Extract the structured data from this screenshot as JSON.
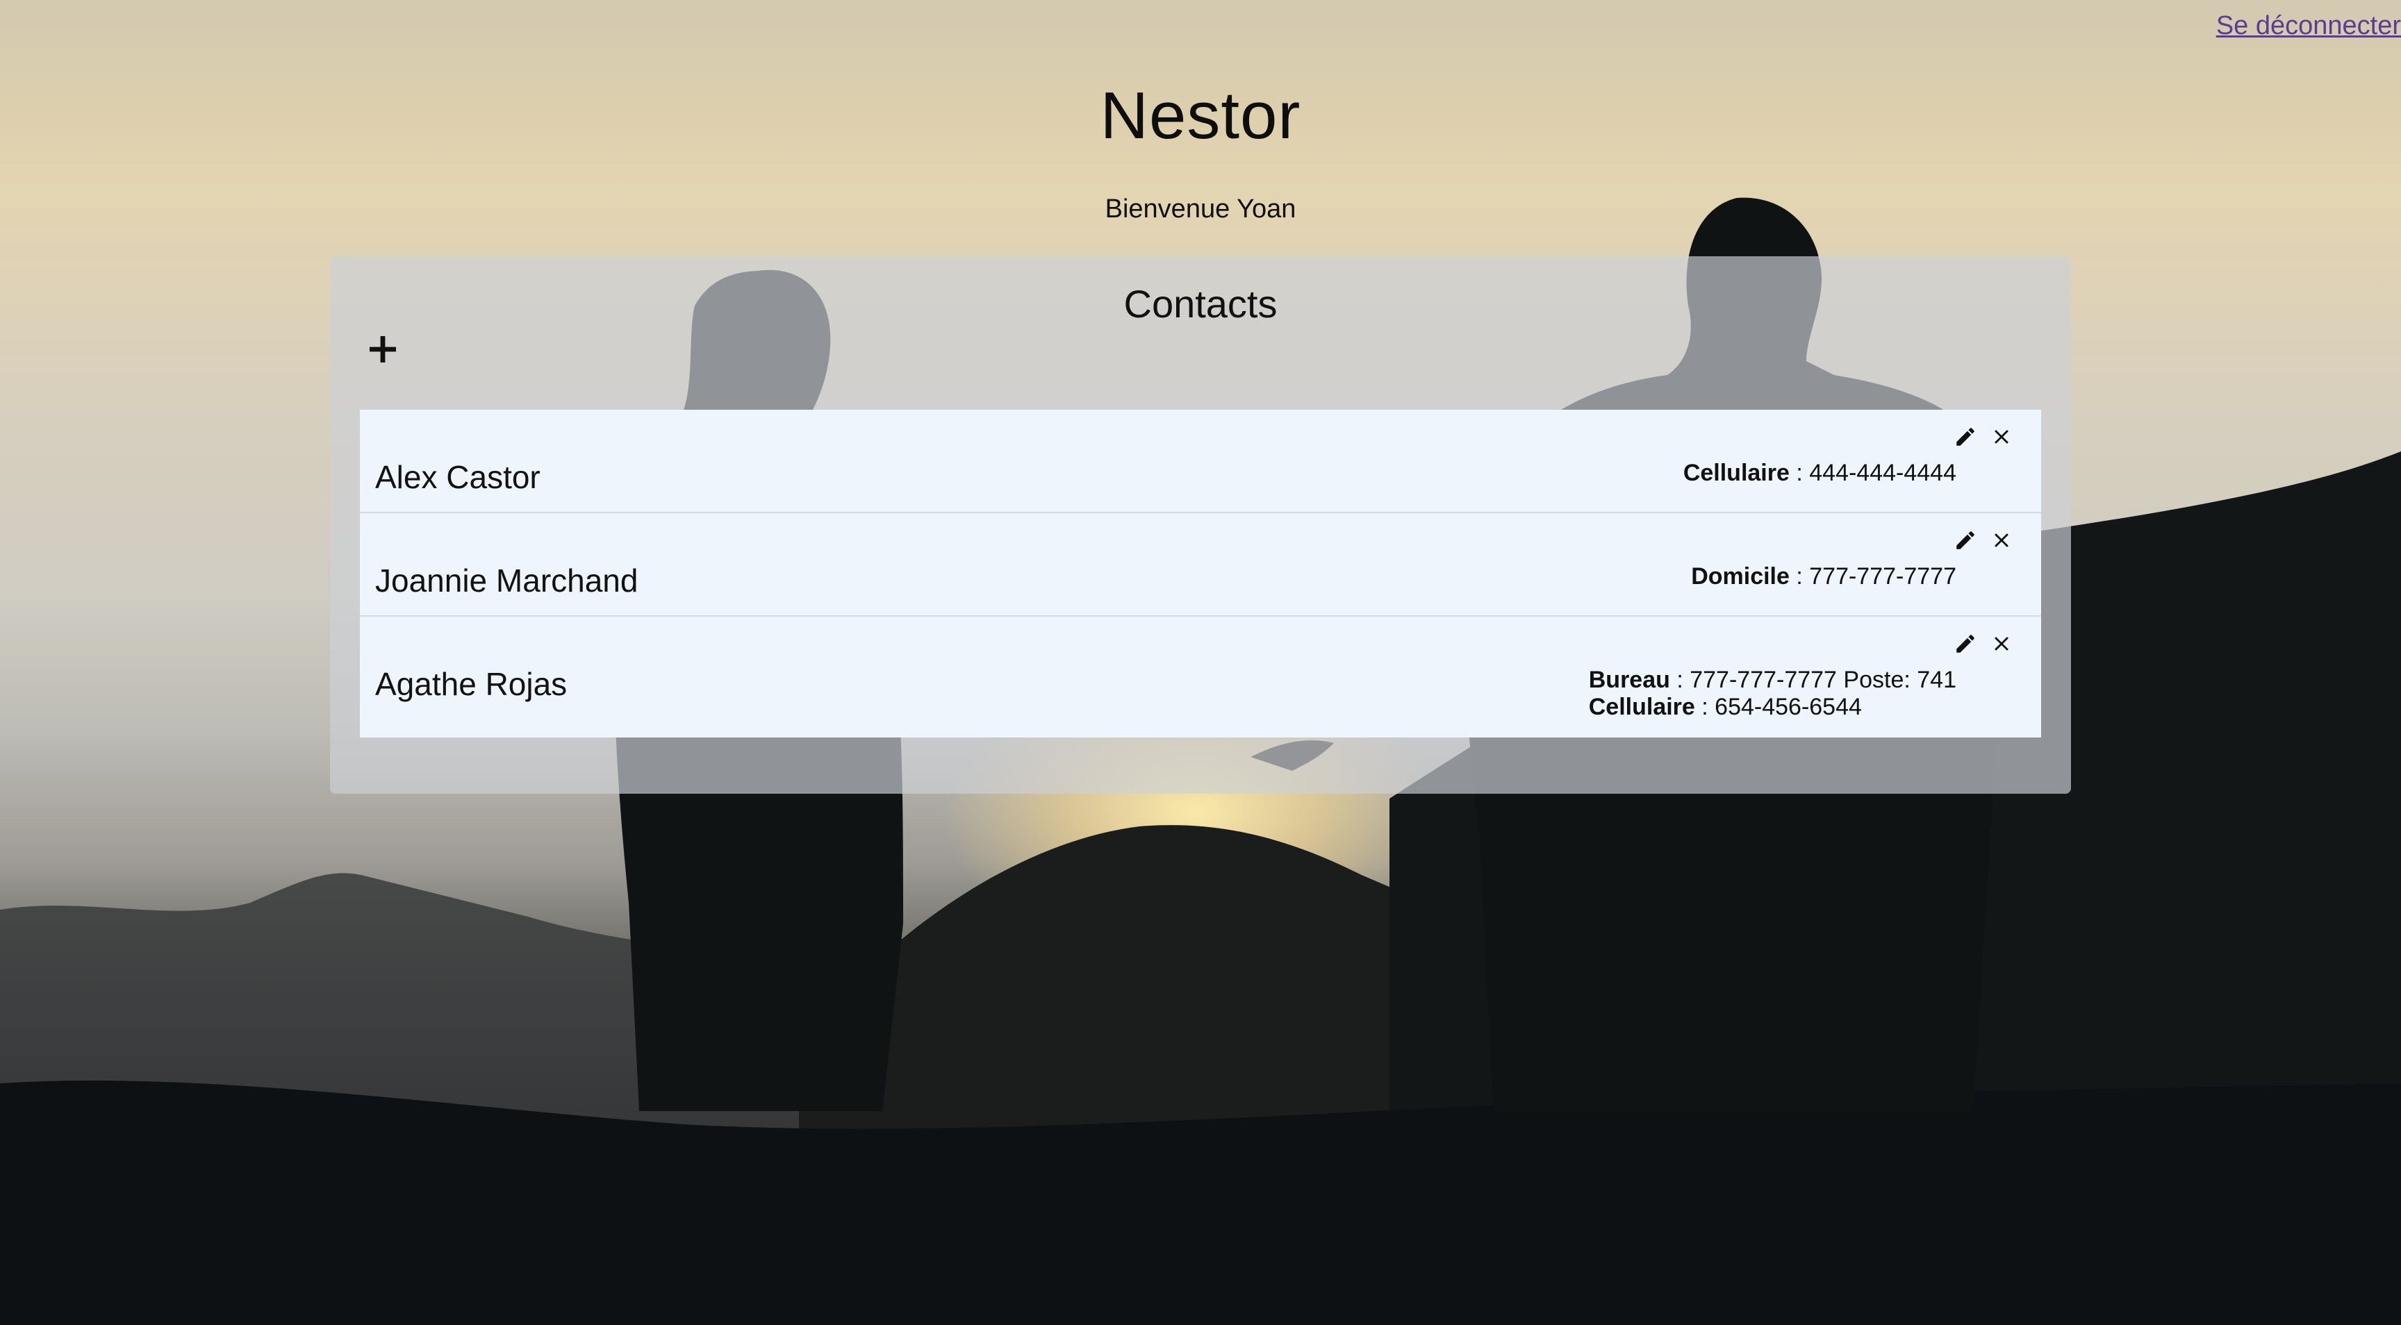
{
  "header": {
    "logout_label": "Se déconnecter",
    "app_title": "Nestor",
    "welcome_text": "Bienvenue Yoan"
  },
  "contacts": {
    "title": "Contacts",
    "add_icon": "plus-icon",
    "edit_icon": "pencil-icon",
    "delete_icon": "close-icon",
    "items": [
      {
        "name": "Alex Castor",
        "phones": [
          {
            "type": "Cellulaire",
            "separator": " : ",
            "number": "444-444-4444",
            "extra": ""
          }
        ]
      },
      {
        "name": "Joannie Marchand",
        "phones": [
          {
            "type": "Domicile",
            "separator": " : ",
            "number": "777-777-7777",
            "extra": ""
          }
        ]
      },
      {
        "name": "Agathe Rojas",
        "phones": [
          {
            "type": "Bureau",
            "separator": " : ",
            "number": "777-777-7777",
            "extra": " Poste: 741"
          },
          {
            "type": "Cellulaire",
            "separator": " : ",
            "number": "654-456-6544",
            "extra": ""
          }
        ]
      }
    ]
  },
  "colors": {
    "link": "#5b3c95",
    "row_background": "#eef5fd"
  }
}
